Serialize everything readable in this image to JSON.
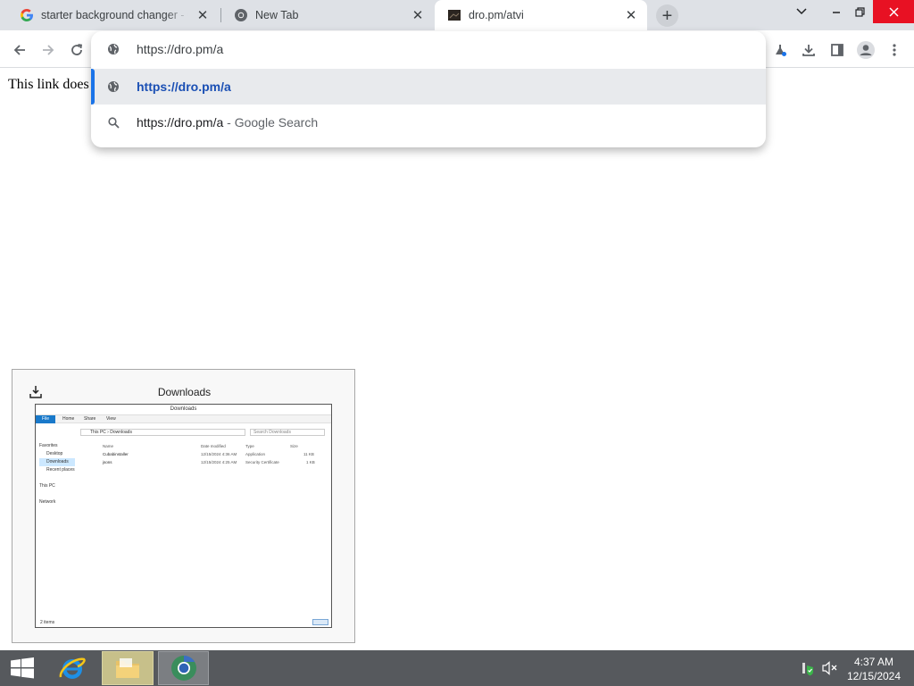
{
  "browser": {
    "tabs": [
      {
        "title": "starter background changer - Go",
        "favicon": "google-g-icon",
        "active": false
      },
      {
        "title": "New Tab",
        "favicon": "chrome-icon",
        "active": false
      },
      {
        "title": "dro.pm/atvi",
        "favicon": "site-dark-icon",
        "active": true
      }
    ],
    "omnibox": {
      "input_value": "https://dro.pm/a",
      "suggestions": [
        {
          "text": "https://dro.pm/a",
          "suffix": "",
          "icon": "globe-icon",
          "selected": true
        },
        {
          "text": "https://dro.pm/a",
          "suffix": " - Google Search",
          "icon": "search-icon",
          "selected": false
        }
      ]
    }
  },
  "page": {
    "text": "This link does"
  },
  "downloads_preview": {
    "title": "Downloads",
    "explorer": {
      "window_title": "Downloads",
      "ribbon": [
        "File",
        "Home",
        "Share",
        "View"
      ],
      "address": "This PC  ›  Downloads",
      "search_placeholder": "Search Downloads",
      "nav": [
        "Favorites",
        "Desktop",
        "Downloads",
        "Recent places",
        "This PC",
        "Network"
      ],
      "columns": [
        "Name",
        "Date modified",
        "Type",
        "Size"
      ],
      "files": [
        {
          "name": "Cubabinstaller",
          "date": "12/15/2024 4:36 AM",
          "type": "Application",
          "size": "11 KB"
        },
        {
          "name": "jsons",
          "date": "12/15/2024 4:25 AM",
          "type": "Security Certificate",
          "size": "1 KB"
        }
      ],
      "status": "2 items"
    }
  },
  "taskbar": {
    "time": "4:37 AM",
    "date": "12/15/2024"
  },
  "colors": {
    "accent": "#1a73e8",
    "taskbar": "#56595d",
    "close_red": "#e81123"
  }
}
